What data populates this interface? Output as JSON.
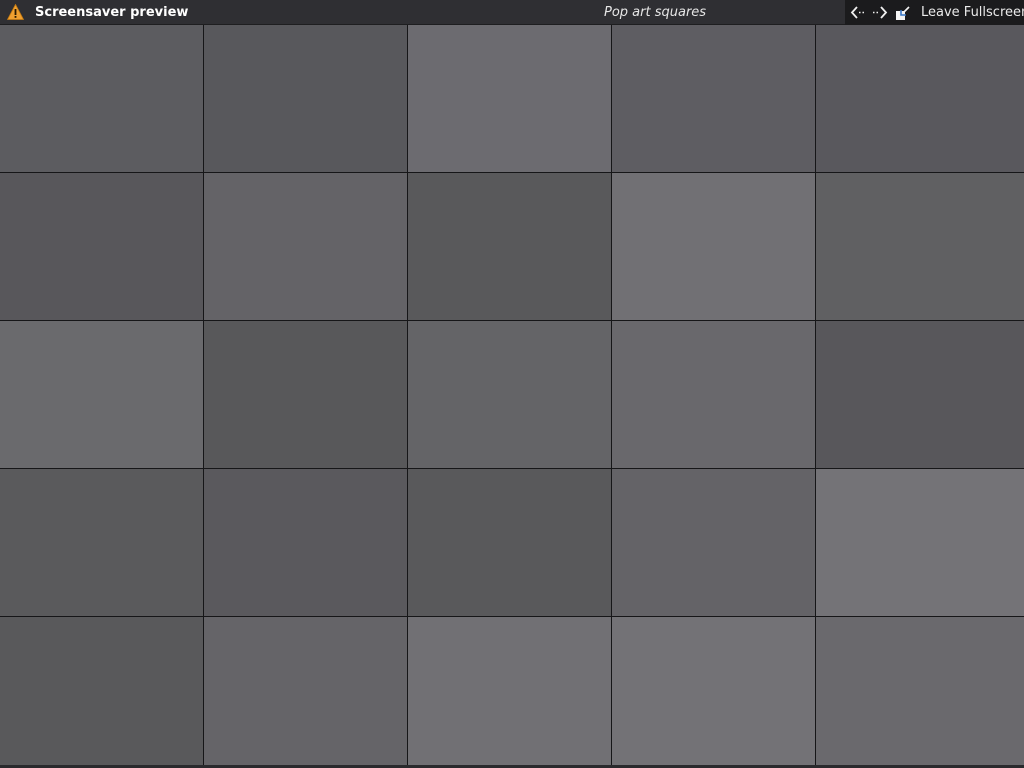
{
  "titlebar": {
    "icon": "warning-icon",
    "title": "Screensaver preview",
    "subtitle": "Pop art squares",
    "controls": {
      "prev_icon": "arrow-left-icon",
      "next_icon": "arrow-right-icon",
      "leave_icon": "leave-fullscreen-icon",
      "leave_label": "Leave Fullscreen"
    }
  },
  "colors": {
    "titlebar_bg": "#2f2f33",
    "accent_warning": "#f0a030",
    "grid_line": "#161618"
  },
  "screensaver": {
    "name": "Pop art squares",
    "rows": 5,
    "columns": 5,
    "tile_colors": [
      [
        "#5c5c60",
        "#58585c",
        "#6c6b70",
        "#5e5d62",
        "#59585d"
      ],
      [
        "#58575b",
        "#646367",
        "#59595b",
        "#717074",
        "#606062"
      ],
      [
        "#6a6a6d",
        "#58585a",
        "#646467",
        "#69686c",
        "#58575b"
      ],
      [
        "#5a5a5c",
        "#5a595d",
        "#59595b",
        "#646367",
        "#747377"
      ],
      [
        "#59595b",
        "#656468",
        "#717074",
        "#737276",
        "#6a696d"
      ]
    ]
  }
}
